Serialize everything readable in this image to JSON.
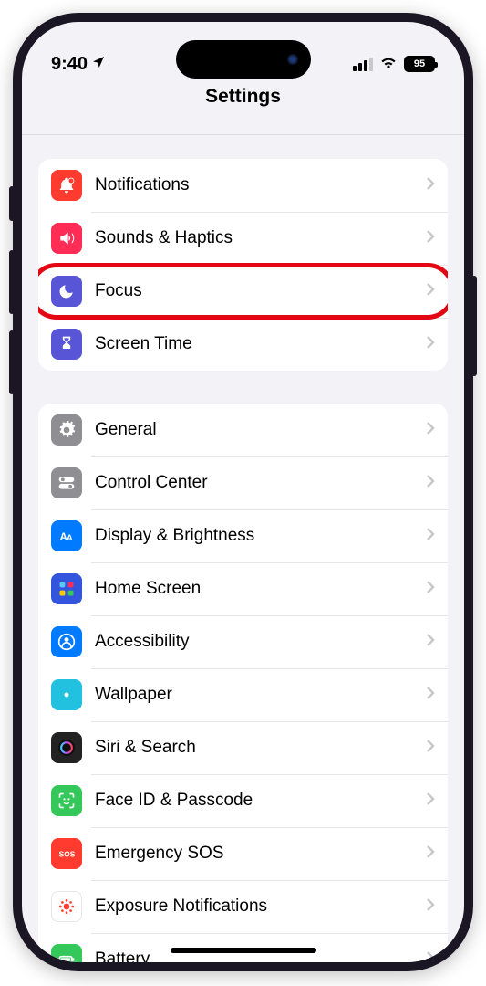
{
  "status": {
    "time": "9:40",
    "battery": "95"
  },
  "navbar": {
    "title": "Settings"
  },
  "groups": [
    {
      "rows": [
        {
          "id": "notifications",
          "label": "Notifications",
          "icon": "bell",
          "color": "#ff3b30"
        },
        {
          "id": "sounds",
          "label": "Sounds & Haptics",
          "icon": "speaker",
          "color": "#ff2d55"
        },
        {
          "id": "focus",
          "label": "Focus",
          "icon": "moon",
          "color": "#5856d6",
          "highlight": true
        },
        {
          "id": "screentime",
          "label": "Screen Time",
          "icon": "hourglass",
          "color": "#5856d6"
        }
      ]
    },
    {
      "rows": [
        {
          "id": "general",
          "label": "General",
          "icon": "gear",
          "color": "#8e8e93"
        },
        {
          "id": "controlcenter",
          "label": "Control Center",
          "icon": "toggles",
          "color": "#8e8e93"
        },
        {
          "id": "display",
          "label": "Display & Brightness",
          "icon": "aa",
          "color": "#007aff"
        },
        {
          "id": "homescreen",
          "label": "Home Screen",
          "icon": "grid",
          "color": "#3355dd"
        },
        {
          "id": "accessibility",
          "label": "Accessibility",
          "icon": "person",
          "color": "#007aff"
        },
        {
          "id": "wallpaper",
          "label": "Wallpaper",
          "icon": "flower",
          "color": "#22c1e0"
        },
        {
          "id": "siri",
          "label": "Siri & Search",
          "icon": "siri",
          "color": "#222"
        },
        {
          "id": "faceid",
          "label": "Face ID & Passcode",
          "icon": "face",
          "color": "#34c759"
        },
        {
          "id": "sos",
          "label": "Emergency SOS",
          "icon": "sos",
          "color": "#ff3b30"
        },
        {
          "id": "exposure",
          "label": "Exposure Notifications",
          "icon": "virus",
          "color": "#fff",
          "iconColor": "#ff3b30",
          "border": true
        },
        {
          "id": "battery",
          "label": "Battery",
          "icon": "battery",
          "color": "#34c759"
        }
      ]
    }
  ]
}
